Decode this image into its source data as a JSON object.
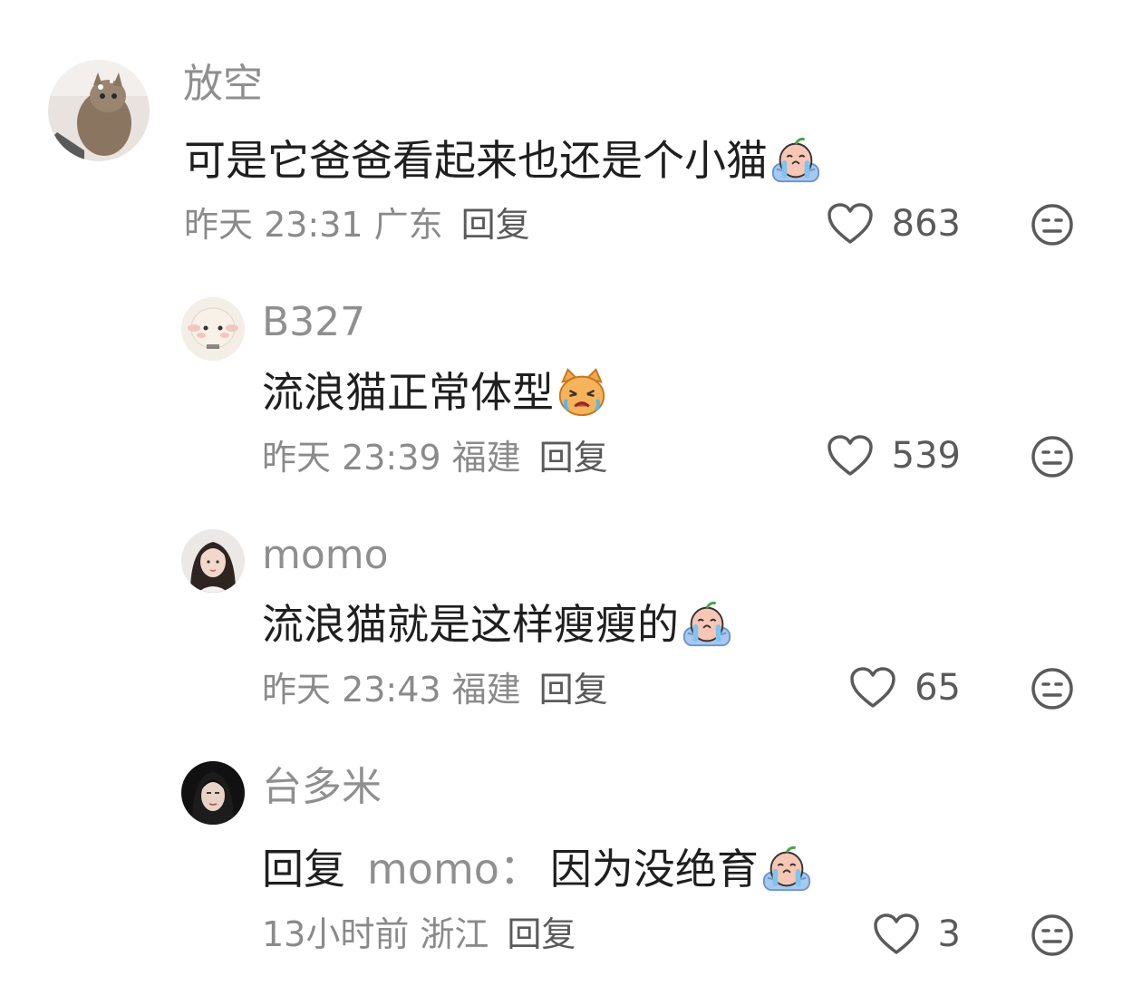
{
  "comments": [
    {
      "username": "放空",
      "text": "可是它爸爸看起来也还是个小猫",
      "emoji": "crying-peach-emoji",
      "time": "昨天 23:31",
      "location": "广东",
      "reply_label": "回复",
      "likes": "863",
      "avatar": "cat-photo-avatar"
    },
    {
      "username": "B327",
      "text": "流浪猫正常体型",
      "emoji": "crying-angry-cat-emoji",
      "time": "昨天 23:39",
      "location": "福建",
      "reply_label": "回复",
      "likes": "539",
      "avatar": "sheep-avatar"
    },
    {
      "username": "momo",
      "text": "流浪猫就是这样瘦瘦的",
      "emoji": "crying-peach-emoji",
      "time": "昨天 23:43",
      "location": "福建",
      "reply_label": "回复",
      "likes": "65",
      "avatar": "woman-avatar"
    },
    {
      "username": "台多米",
      "reply_prefix": "回复",
      "mention": "momo",
      "colon": "：",
      "text": "因为没绝育",
      "emoji": "crying-peach-emoji",
      "time": "13小时前",
      "location": "浙江",
      "reply_label": "回复",
      "likes": "3",
      "avatar": "woman-dark-avatar"
    }
  ],
  "colors": {
    "username": "#8f8f8f",
    "content": "#1f1f1f",
    "meta": "#8a8a8a",
    "icon": "#5a5a5a"
  }
}
